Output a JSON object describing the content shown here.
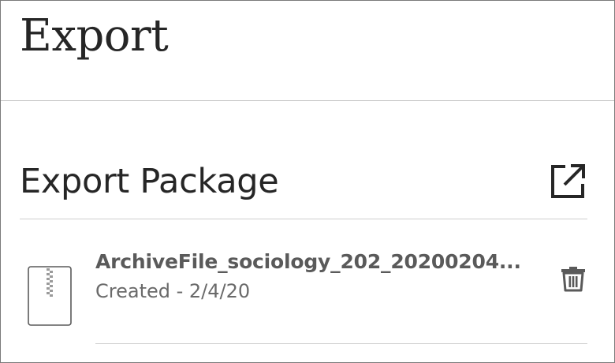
{
  "page": {
    "title": "Export"
  },
  "export_section": {
    "title": "Export Package",
    "export_icon": "open-in-new-icon"
  },
  "packages": [
    {
      "name": "ArchiveFile_sociology_202_20200204...",
      "created": "Created - 2/4/20",
      "file_icon": "zip-file-icon",
      "delete_icon": "trash-icon"
    }
  ],
  "colors": {
    "text_dark": "#262626",
    "text_muted": "#5a5a5a",
    "divider": "#cfcfcf",
    "icon": "#262626"
  }
}
